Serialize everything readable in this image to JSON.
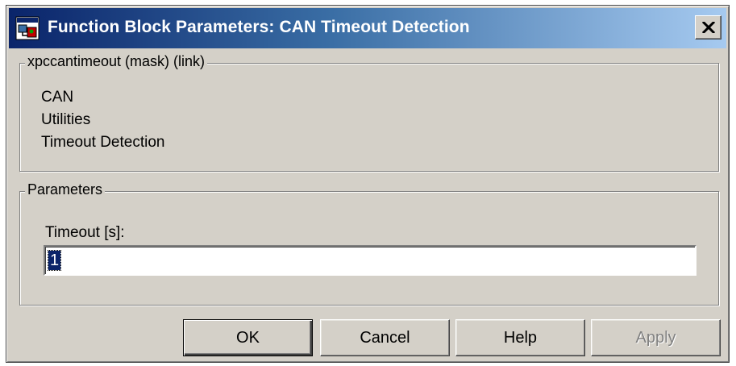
{
  "window": {
    "title": "Function Block Parameters: CAN Timeout Detection",
    "app_icon": "simulink-block-icon",
    "close_icon": "close-icon"
  },
  "mask_group": {
    "legend": "xpccantimeout (mask) (link)",
    "description_lines": [
      "CAN",
      "Utilities",
      "Timeout Detection"
    ]
  },
  "parameters_group": {
    "legend": "Parameters",
    "timeout_label": "Timeout [s]:",
    "timeout_value": "1"
  },
  "buttons": {
    "ok": "OK",
    "cancel": "Cancel",
    "help": "Help",
    "apply": "Apply"
  },
  "colors": {
    "titlebar_start": "#0a246a",
    "titlebar_end": "#a6caf0",
    "dialog_face": "#d4d0c8",
    "selection": "#0a246a"
  }
}
